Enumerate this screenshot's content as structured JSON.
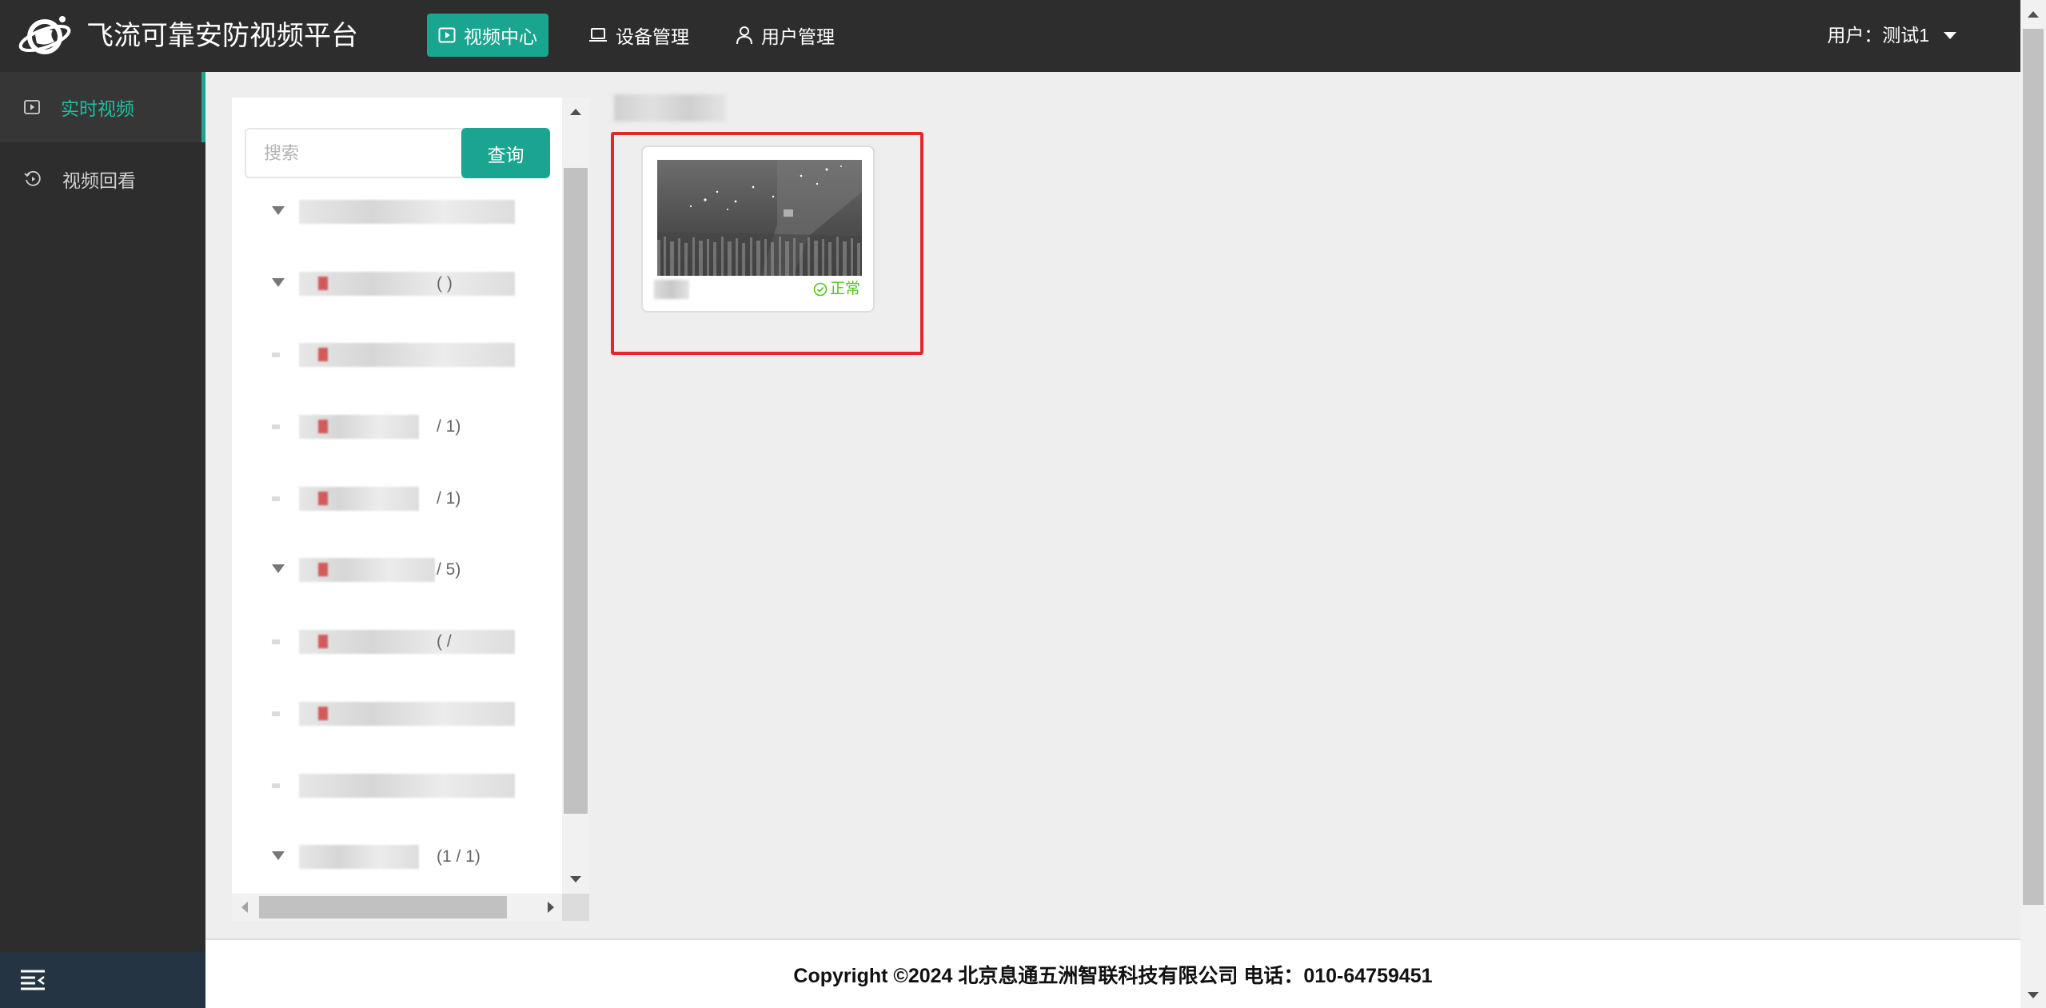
{
  "app": {
    "title": "飞流可靠安防视频平台",
    "logo_icon": "globe-logo-icon"
  },
  "nav": {
    "tabs": [
      {
        "label": "视频中心",
        "icon": "video-play-icon",
        "active": true
      },
      {
        "label": "设备管理",
        "icon": "laptop-icon",
        "active": false
      },
      {
        "label": "用户管理",
        "icon": "user-icon",
        "active": false
      }
    ]
  },
  "user": {
    "label": "用户：测试1"
  },
  "sidebar": {
    "items": [
      {
        "label": "实时视频",
        "icon": "live-video-icon",
        "active": true
      },
      {
        "label": "视频回看",
        "icon": "playback-icon",
        "active": false
      }
    ],
    "collapse_icon": "menu-collapse-icon"
  },
  "tree": {
    "search": {
      "placeholder": "搜索",
      "button_label": "查询"
    },
    "nodes": [
      {
        "count": ""
      },
      {
        "count": "( )"
      },
      {
        "count": ""
      },
      {
        "count": "/ 1)"
      },
      {
        "count": "/ 1)"
      },
      {
        "count": "/ 5)"
      },
      {
        "count": "( /"
      },
      {
        "count": ""
      },
      {
        "count": ""
      },
      {
        "count": "(1 / 1)"
      }
    ]
  },
  "content": {
    "camera_card": {
      "status": "正常",
      "status_icon": "check-circle-icon"
    }
  },
  "footer": {
    "text": "Copyright ©2024 北京息通五洲智联科技有限公司 电话：010-64759451"
  },
  "colors": {
    "header_bg": "#2d2d2d",
    "accent": "#1aa590",
    "status_ok": "#52c41a",
    "highlight": "#e8262a"
  }
}
